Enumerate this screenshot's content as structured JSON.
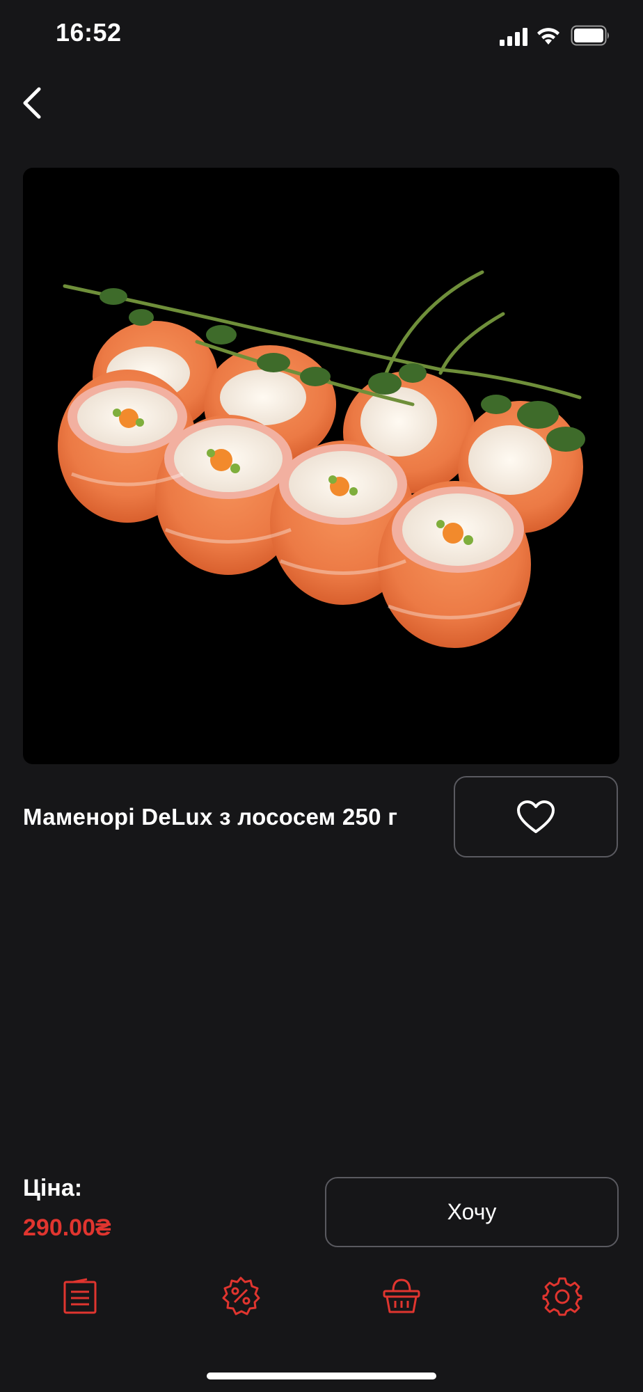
{
  "status_bar": {
    "time": "16:52",
    "icons": [
      "cellular-signal-icon",
      "wifi-icon",
      "battery-icon"
    ]
  },
  "navigation": {
    "back_icon": "chevron-left-icon"
  },
  "product": {
    "image_subject": "salmon sushi rolls with pea shoots",
    "title": "Маменорі DeLux з лососем 250 г",
    "favorite_icon": "heart-outline-icon",
    "price_label": "Ціна:",
    "price": "290.00₴",
    "order_button_label": "Хочу"
  },
  "bottom_nav": {
    "items": [
      {
        "icon": "menu-list-icon"
      },
      {
        "icon": "discount-percent-icon"
      },
      {
        "icon": "basket-icon"
      },
      {
        "icon": "settings-gear-icon"
      }
    ]
  },
  "colors": {
    "background": "#161618",
    "accent": "#e0352f",
    "border": "#5a5a60",
    "text": "#ffffff"
  }
}
